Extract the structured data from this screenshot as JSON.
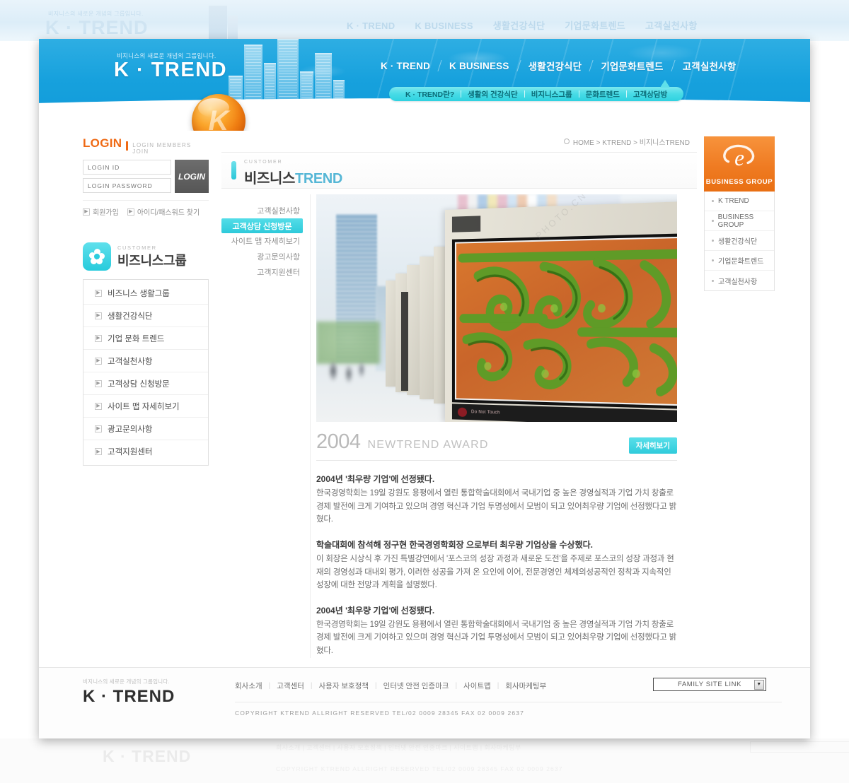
{
  "ghost": {
    "logo_sub": "비지니스의 새로운 개념의 그룹입니다.",
    "logo": "K · TREND",
    "nav": [
      "K · TREND",
      "K BUSINESS",
      "생활건강식단",
      "기업문화트렌드",
      "고객실천사항"
    ],
    "footer_logo": "K · TREND",
    "footer_links": "회사소개 | 고객센터 | 사용자 보호정책 | 인터넷 안전 인증마크 | 사이트맵 | 회사마케팅부",
    "footer_copy": "COPYRIGHT KTREND ALLRIGHT RESERVED  TEL/02 0009 28345  FAX 02 0009 2637",
    "select": "FAMILY SITE LINK"
  },
  "header": {
    "logo_sub": "비지니스의 새로운 개념의 그룹입니다.",
    "logo": "K · TREND",
    "orb_letter": "K",
    "nav": [
      {
        "label": "K · TREND"
      },
      {
        "label": "K BUSINESS"
      },
      {
        "label": "생활건강식단"
      },
      {
        "label": "기업문화트렌드"
      },
      {
        "label": "고객실천사항"
      }
    ],
    "subnav": [
      {
        "label": "K · TREND란?"
      },
      {
        "label": "생활의 건강식단"
      },
      {
        "label": "비지니스그룹"
      },
      {
        "label": "문화트렌드"
      },
      {
        "label": "고객상담방"
      }
    ]
  },
  "login": {
    "title": "LOGIN",
    "subtitle": "Login members join",
    "id_placeholder": "LOGIN ID",
    "pw_placeholder": "LOGIN PASSWORD",
    "button": "LOGIN",
    "links": [
      {
        "label": "회원가입"
      },
      {
        "label": "아이디/패스워드 찾기"
      }
    ]
  },
  "sidebar": {
    "eyebrow": "CUSTOMER",
    "title": "비즈니스그룹",
    "items": [
      {
        "label": "비즈니스 생활그룹"
      },
      {
        "label": "생활건강식단"
      },
      {
        "label": "기업 문화 트렌드"
      },
      {
        "label": "고객실천사항"
      },
      {
        "label": "고객상담 신청방문"
      },
      {
        "label": "사이트 맵 자세히보기"
      },
      {
        "label": "광고문의사항"
      },
      {
        "label": "고객지원센터"
      }
    ]
  },
  "content": {
    "breadcrumb": "HOME > KTREND > 비지니스TREND",
    "page_eyebrow": "CUSTOMER",
    "page_title_ko": "비즈니스",
    "page_title_en": "TREND",
    "inner_nav": [
      {
        "label": "고객실천사항",
        "active": false
      },
      {
        "label": "고객상담 신청방문",
        "active": true
      },
      {
        "label": "사이트 맵 자세히보기",
        "active": false
      },
      {
        "label": "광고문의사항",
        "active": false
      },
      {
        "label": "고객지원센터",
        "active": false
      }
    ],
    "award_year": "2004",
    "award_name": "NEWTREND AWARD",
    "more_button": "자세히보기",
    "paragraphs": [
      {
        "heading": "2004년 '최우량 기업'에 선정됐다.",
        "text": "한국경영학회는 19일 강원도 용평에서 열린 통합학술대회에서 국내기업 중 높은 경영실적과 기업 가치 창출로 경제 발전에 크게 기여하고 있으며 경영 혁신과 기업 투명성에서 모범이 되고 있어최우량 기업에 선정했다고 밝혔다."
      },
      {
        "heading": "학술대회에 참석해 정구현 한국경영학회장 으로부터 최우량 기업상을 수상했다.",
        "text": "이 회장은 시상식 후 가진 특별강연에서 '포스코의 성장 과정과 새로운 도전'을 주제로 포스코의 성장 과정과 현재의 경영성과 대내외 평가, 이러한 성공을 가져 온 요인에 이어, 전문경영인 체제의성공적인 정착과 지속적인 성장에 대한 전망과 계획을 설명했다."
      },
      {
        "heading": "2004년 '최우량 기업'에 선정됐다.",
        "text": "한국경영학회는 19일 강원도 용평에서 열린 통합학술대회에서 국내기업 중 높은 경영실적과 기업 가치 창출로 경제 발전에 크게 기여하고 있으며 경영 혁신과 기업 투명성에서 모범이 되고 있어최우량 기업에 선정했다고 밝혔다."
      }
    ],
    "billboard_caption": "Do Not Touch"
  },
  "rightrail": {
    "title": "BUSINESS GROUP",
    "items": [
      {
        "label": "K TREND"
      },
      {
        "label": "BUSINESS GROUP"
      },
      {
        "label": "생활건강식단"
      },
      {
        "label": "기업문화트렌드"
      },
      {
        "label": "고객실천사항"
      }
    ]
  },
  "footer": {
    "logo_sub": "비지니스의 새로운 개념의 그룹입니다.",
    "logo": "K · TREND",
    "links": [
      {
        "label": "회사소개"
      },
      {
        "label": "고객센터"
      },
      {
        "label": "사용자 보호정책"
      },
      {
        "label": "인터넷 안전 인증마크"
      },
      {
        "label": "사이트맵"
      },
      {
        "label": "회사마케팅부"
      }
    ],
    "select_value": "FAMILY SITE LINK",
    "copyright": "COPYRIGHT KTREND ALLRIGHT RESERVED  TEL/02 0009 28345  FAX 02 0009 2637"
  },
  "watermark": {
    "text": "PHOTO.CN"
  },
  "colors": {
    "header_blue": "#17a1dd",
    "cyan": "#2ecada",
    "orange": "#ef7b22",
    "login_orange": "#ef6a15"
  }
}
